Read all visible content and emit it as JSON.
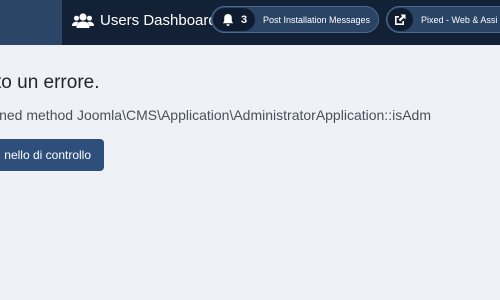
{
  "header": {
    "title": "Users Dashboard",
    "title_icon": "users-icon",
    "messages": {
      "icon": "bell-icon",
      "count": "3",
      "label": "Post Installation Messages"
    },
    "site": {
      "icon": "external-link-icon",
      "label": "Pixed - Web & Assi"
    }
  },
  "main": {
    "error_heading": "to un errore.",
    "error_message": "ined method Joomla\\CMS\\Application\\AdministratorApplication::isAdm",
    "back_button_label": "nello di controllo"
  },
  "colors": {
    "header_bg": "#132137",
    "header_left_bg": "#2b4567",
    "pill_bg": "#2a4466",
    "button_bg": "#2e4f7c",
    "page_bg": "#eef2f7"
  }
}
